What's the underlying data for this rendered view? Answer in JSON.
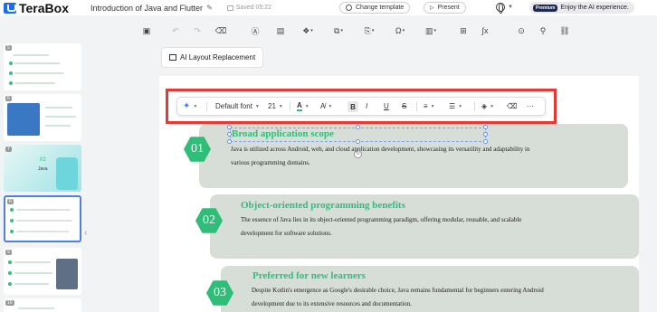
{
  "app": {
    "logo_text": "TeraBox",
    "doc_title": "Introduction of Java and Flutter",
    "saved_status": "Saved 05:22",
    "change_template_label": "Change template",
    "present_label": "Present",
    "premium_badge": "Premium",
    "ai_experience_label": "Enjoy the AI experience.",
    "brand_color": "#1a6cf0"
  },
  "toolbar": {
    "icons": [
      "save-icon",
      "undo-icon",
      "redo-icon",
      "format-painter-icon",
      "text-box-icon",
      "image-icon",
      "shapes-icon",
      "table-icon",
      "chart-icon",
      "smartart-icon",
      "omega-symbol-icon",
      "chart-insert-icon",
      "grid-icon",
      "formula-icon",
      "settings-icon",
      "search-icon",
      "link-icon"
    ]
  },
  "canvas": {
    "ai_layout_label": "AI Layout Replacement"
  },
  "format_toolbar": {
    "font_name": "Default font",
    "font_size": "21",
    "bold": "B",
    "italic": "I",
    "underline": "U",
    "strike": "S",
    "more": "···"
  },
  "slide": {
    "accent_color": "#2fbe78",
    "items": [
      {
        "number": "01",
        "title": "Broad application scope",
        "desc_line1": "Java is utilized across Android, web, and cloud application development, showcasing its versatility and adaptability in",
        "desc_line2": "various programming domains."
      },
      {
        "number": "02",
        "title": "Object-oriented programming benefits",
        "desc_line1": "The essence of Java lies in its object-oriented programming paradigm, offering modular, reusable, and scalable",
        "desc_line2": "development for software solutions."
      },
      {
        "number": "03",
        "title": "Preferred for new learners",
        "desc_line1": "Despite Kotlin's emergence as Google's desirable choice, Java remains fundamental for beginners entering Android",
        "desc_line2": "development due to its extensive resources and documentation."
      }
    ]
  },
  "thumbnails": [
    {
      "number": "5"
    },
    {
      "number": "6"
    },
    {
      "number": "7",
      "text_top": "02",
      "text_bottom": "Java"
    },
    {
      "number": "8"
    },
    {
      "number": "9"
    },
    {
      "number": "10"
    }
  ]
}
